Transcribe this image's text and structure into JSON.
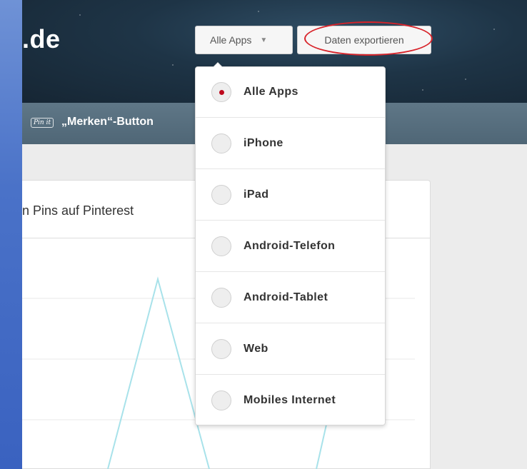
{
  "header": {
    "site_name": ".de",
    "apps_dropdown_label": "Alle Apps",
    "export_button_label": "Daten exportieren"
  },
  "nav": {
    "pin_badge": "Pin it",
    "merken_label": "„Merken“-Button"
  },
  "card": {
    "title": "n Pins auf Pinterest"
  },
  "dropdown": {
    "selected": "Alle Apps",
    "options": [
      {
        "label": "Alle Apps",
        "checked": true
      },
      {
        "label": "iPhone",
        "checked": false
      },
      {
        "label": "iPad",
        "checked": false
      },
      {
        "label": "Android-Telefon",
        "checked": false
      },
      {
        "label": "Android-Tablet",
        "checked": false
      },
      {
        "label": "Web",
        "checked": false
      },
      {
        "label": "Mobiles Internet",
        "checked": false
      }
    ]
  },
  "colors": {
    "accent_red": "#bd081c",
    "highlight_ellipse": "#d8232a",
    "chart_line": "#a8e2ea"
  }
}
